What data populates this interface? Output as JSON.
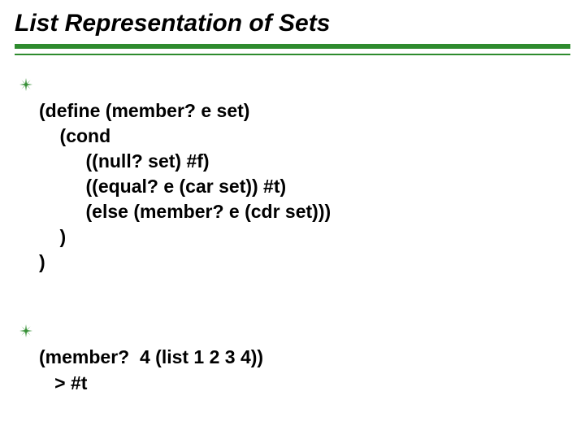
{
  "title": "List Representation of Sets",
  "block1": {
    "l1": "(define (member? e set)",
    "l2": "    (cond",
    "l3": "         ((null? set) #f)",
    "l4": "         ((equal? e (car set)) #t)",
    "l5": "         (else (member? e (cdr set)))",
    "l6": "    )",
    "l7": ")"
  },
  "block2": {
    "l1": "(member?  4 (list 1 2 3 4))",
    "l2": "   > #t"
  }
}
